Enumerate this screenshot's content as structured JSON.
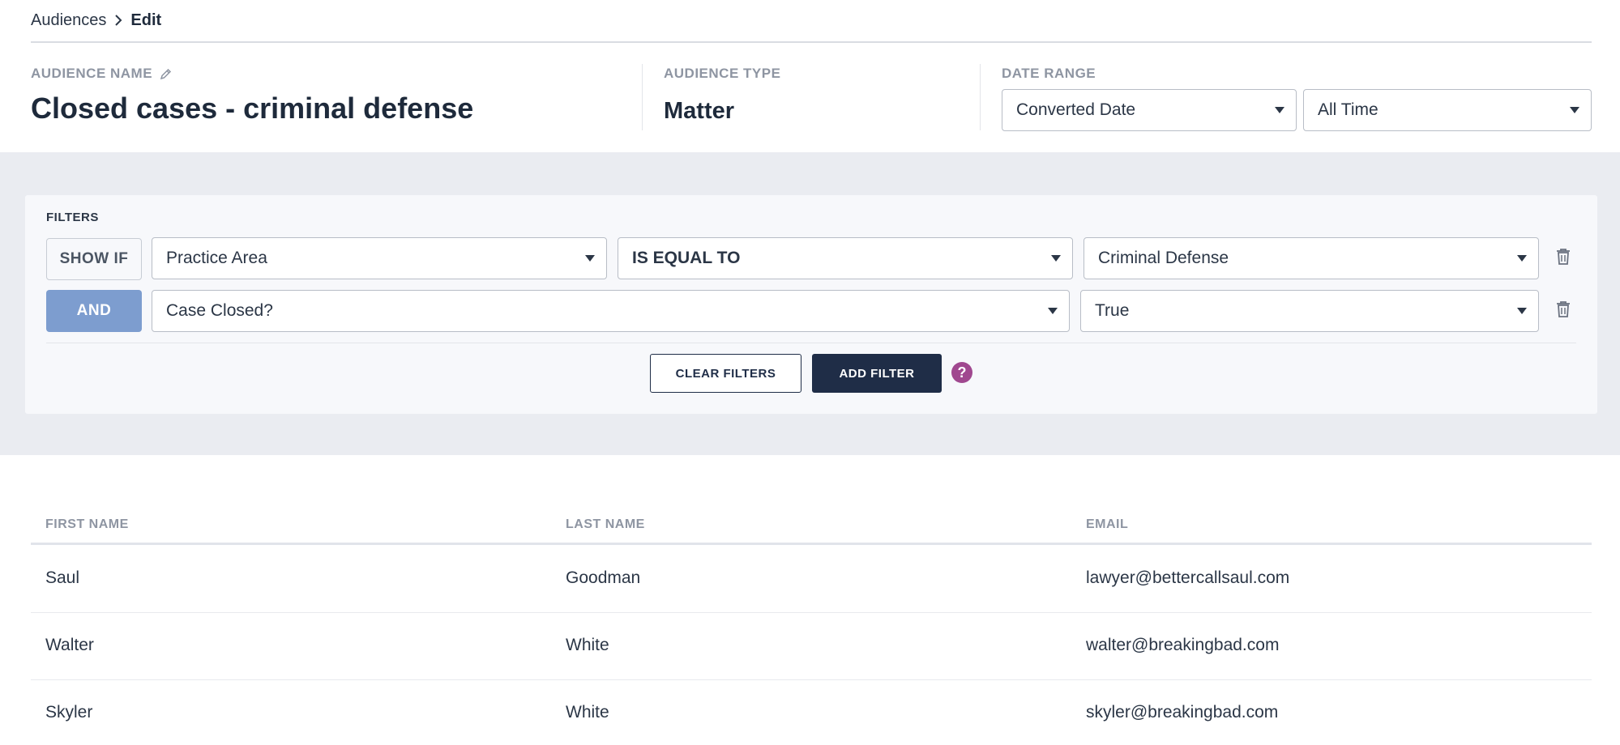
{
  "breadcrumb": {
    "parent": "Audiences",
    "current": "Edit"
  },
  "header": {
    "audience_name_label": "AUDIENCE NAME",
    "audience_name": "Closed cases - criminal defense",
    "audience_type_label": "AUDIENCE TYPE",
    "audience_type": "Matter",
    "date_range_label": "DATE RANGE",
    "date_field": "Converted Date",
    "date_period": "All Time"
  },
  "filters": {
    "label": "FILTERS",
    "rows": [
      {
        "connector": "SHOW IF",
        "field": "Practice Area",
        "operator": "IS EQUAL TO",
        "value": "Criminal Defense"
      },
      {
        "connector": "AND",
        "field": "Case Closed?",
        "value": "True"
      }
    ],
    "clear_label": "CLEAR FILTERS",
    "add_label": "ADD FILTER",
    "help_glyph": "?"
  },
  "table": {
    "columns": [
      "FIRST NAME",
      "LAST NAME",
      "EMAIL"
    ],
    "rows": [
      [
        "Saul",
        "Goodman",
        "lawyer@bettercallsaul.com"
      ],
      [
        "Walter",
        "White",
        "walter@breakingbad.com"
      ],
      [
        "Skyler",
        "White",
        "skyler@breakingbad.com"
      ]
    ]
  },
  "colors": {
    "navy": "#1f2d47",
    "and_chip": "#7d9dcf",
    "help_icon": "#a0488f",
    "band_bg": "#eaecf1"
  },
  "icons": {
    "breadcrumb_sep": "chevron-right-icon",
    "edit_name": "pencil-icon",
    "dropdown": "caret-down-icon",
    "remove_filter": "trash-icon",
    "help": "question-icon"
  }
}
